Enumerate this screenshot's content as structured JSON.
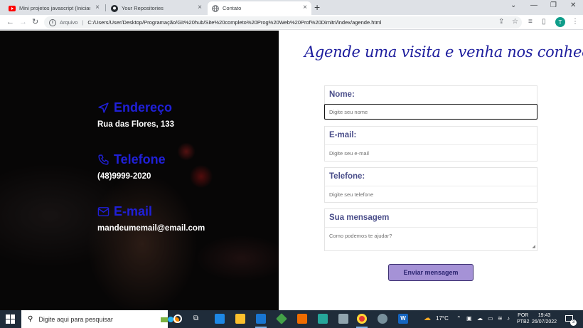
{
  "browser": {
    "tabs": [
      {
        "title": "Mini projetos javascript (Iniciante",
        "icon": "youtube-icon"
      },
      {
        "title": "Your Repositories",
        "icon": "github-icon"
      },
      {
        "title": "Contato",
        "icon": "globe-icon",
        "active": true
      }
    ],
    "address": {
      "scheme": "Arquivo",
      "url": "C:/Users/User/Desktop/Programação/Git%20hub/Site%20completo%20Prog%20Web%20Prof%20Dimitri/index/agende.html"
    },
    "profile_initial": "T"
  },
  "page": {
    "heading": "Agende uma visita e venha nos conhecer!",
    "contacts": [
      {
        "title": "Endereço",
        "value": "Rua das Flores, 133",
        "icon": "location-arrow-icon"
      },
      {
        "title": "Telefone",
        "value": "(48)9999-2020",
        "icon": "phone-icon"
      },
      {
        "title": "E-mail",
        "value": "mandeumemail@email.com",
        "icon": "envelope-icon"
      }
    ],
    "form": {
      "name": {
        "label": "Nome:",
        "placeholder": "Digite seu nome"
      },
      "email": {
        "label": "E-mail:",
        "placeholder": "Digite seu e-mail"
      },
      "phone": {
        "label": "Telefone:",
        "placeholder": "Digite seu telefone"
      },
      "message": {
        "label": "Sua mensagem",
        "placeholder": "Como podemos te ajudar?"
      },
      "submit_label": "Enviar mensagem"
    },
    "colors": {
      "accent": "#2020d8",
      "heading": "#1e1e9e",
      "button": "#a592d6"
    }
  },
  "taskbar": {
    "search_placeholder": "Digite aqui para pesquisar",
    "weather": "17°C",
    "language": "POR",
    "keyboard": "PTB2",
    "time": "19:43",
    "date": "26/07/2022",
    "notification_count": "3"
  }
}
